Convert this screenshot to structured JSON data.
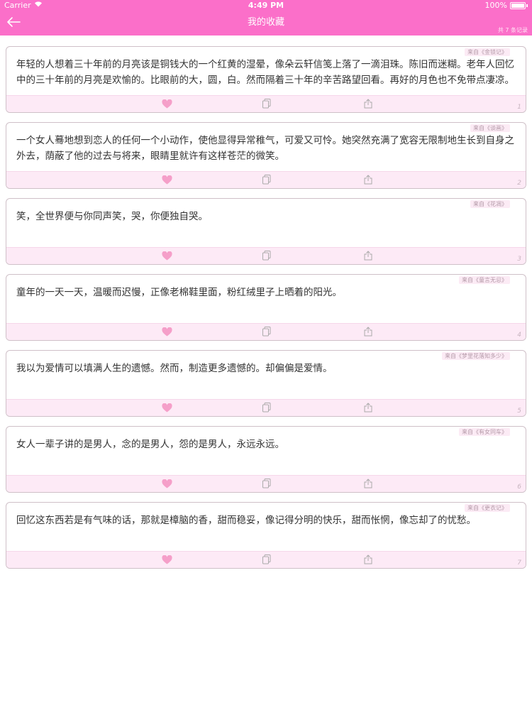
{
  "status_bar": {
    "carrier": "Carrier",
    "time": "4:49 PM",
    "battery": "100%"
  },
  "nav": {
    "title": "我的收藏",
    "count": "共 7 条记录"
  },
  "colors": {
    "accent": "#fb6fc9",
    "toolbar_bg": "#fdeaf6",
    "heart": "#f59fc9"
  },
  "icons": {
    "back": "arrow-left-icon",
    "like": "heart-icon",
    "copy": "copy-icon",
    "share": "share-icon"
  },
  "items": [
    {
      "source": "来自《金锁记》",
      "text": "年轻的人想着三十年前的月亮该是铜钱大的一个红黄的湿晕，像朵云轩信笺上落了一滴泪珠。陈旧而迷糊。老年人回忆中的三十年前的月亮是欢愉的。比眼前的大，圆，白。然而隔着三十年的辛苦路望回看。再好的月色也不免带点凄凉。",
      "index": "1"
    },
    {
      "source": "来自《谈画》",
      "text": "一个女人蓦地想到恋人的任何一个小动作，使他显得异常稚气，可爱又可怜。她突然充满了宽容无限制地生长到自身之外去，荫蔽了他的过去与将来，眼睛里就许有这样苍茫的微笑。",
      "index": "2"
    },
    {
      "source": "来自《花凋》",
      "text": "笑，全世界便与你同声笑，哭，你便独自哭。",
      "index": "3"
    },
    {
      "source": "来自《童言无忌》",
      "text": "童年的一天一天，温暖而迟慢，正像老棉鞋里面，粉红绒里子上晒着的阳光。",
      "index": "4"
    },
    {
      "source": "来自《梦里花落知多少》",
      "text": "我以为爱情可以填满人生的遗憾。然而，制造更多遗憾的。却偏偏是爱情。",
      "index": "5"
    },
    {
      "source": "来自《有女同车》",
      "text": "女人一辈子讲的是男人，念的是男人，怨的是男人，永远永远。",
      "index": "6"
    },
    {
      "source": "来自《更衣记》",
      "text": "回忆这东西若是有气味的话，那就是樟脑的香，甜而稳妥，像记得分明的快乐，甜而怅惘，像忘却了的忧愁。",
      "index": "7"
    }
  ]
}
